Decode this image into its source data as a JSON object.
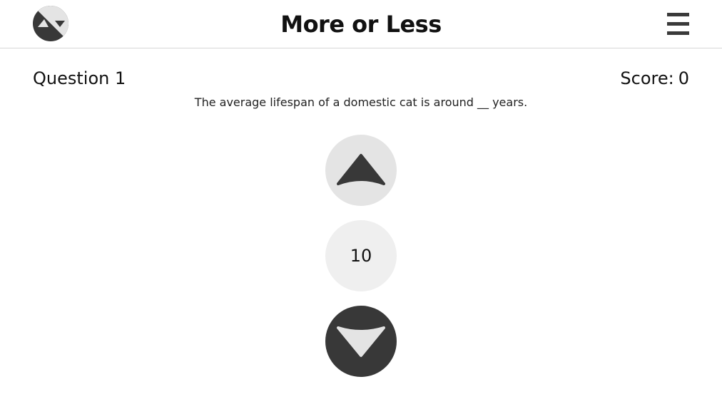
{
  "header": {
    "title": "More or Less",
    "logo_icon": "up-down-logo-icon",
    "menu_icon": "hamburger-menu-icon"
  },
  "question": {
    "label": "Question 1",
    "text": "The average lifespan of a domestic cat is around __ years."
  },
  "score": {
    "label": "Score:",
    "value": "0"
  },
  "controls": {
    "up_icon": "arrow-up-icon",
    "current_value": "10",
    "down_icon": "arrow-down-icon"
  },
  "colors": {
    "dark": "#383838",
    "light_circle": "#e4e4e4",
    "value_circle": "#efefef",
    "divider": "#d6d6d6"
  }
}
